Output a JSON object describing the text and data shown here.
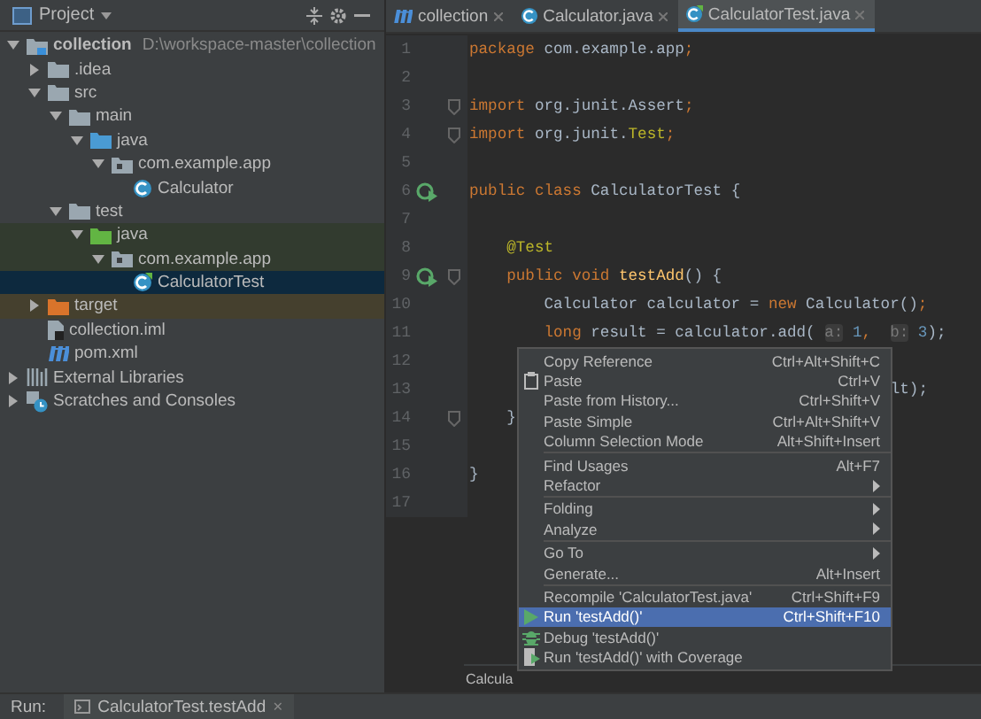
{
  "project_panel": {
    "title": "Project",
    "tree": [
      {
        "label": "collection",
        "path": "D:\\workspace-master\\collection",
        "kind": "module",
        "expanded": true,
        "selected": false,
        "children": [
          {
            "label": ".idea",
            "kind": "folder",
            "expanded": false,
            "selected": false
          },
          {
            "label": "src",
            "kind": "folder",
            "expanded": true,
            "selected": false,
            "children": [
              {
                "label": "main",
                "kind": "folder",
                "expanded": true,
                "selected": false,
                "children": [
                  {
                    "label": "java",
                    "kind": "source-folder",
                    "expanded": true,
                    "selected": false,
                    "children": [
                      {
                        "label": "com.example.app",
                        "kind": "package",
                        "expanded": true,
                        "selected": false,
                        "children": [
                          {
                            "label": "Calculator",
                            "kind": "class",
                            "selected": false
                          }
                        ]
                      }
                    ]
                  }
                ]
              },
              {
                "label": "test",
                "kind": "folder",
                "expanded": true,
                "selected": false,
                "children": [
                  {
                    "label": "java",
                    "kind": "test-folder",
                    "test_scope": true,
                    "expanded": true,
                    "selected": false,
                    "children": [
                      {
                        "label": "com.example.app",
                        "kind": "package",
                        "test_scope": true,
                        "expanded": true,
                        "selected": false,
                        "children": [
                          {
                            "label": "CalculatorTest",
                            "kind": "test-class",
                            "selected": true
                          }
                        ]
                      }
                    ]
                  }
                ]
              }
            ]
          },
          {
            "label": "target",
            "kind": "excluded-folder",
            "excluded": true,
            "expanded": false,
            "selected": false
          },
          {
            "label": "collection.iml",
            "kind": "iml-file",
            "selected": false
          },
          {
            "label": "pom.xml",
            "kind": "maven-file",
            "selected": false
          }
        ]
      },
      {
        "label": "External Libraries",
        "kind": "libraries",
        "expanded": false,
        "selected": false
      },
      {
        "label": "Scratches and Consoles",
        "kind": "scratches",
        "expanded": false,
        "selected": false
      }
    ]
  },
  "editor_tabs": [
    {
      "label": "collection",
      "kind": "maven",
      "selected": false
    },
    {
      "label": "Calculator.java",
      "kind": "class",
      "selected": false
    },
    {
      "label": "CalculatorTest.java",
      "kind": "test-class",
      "selected": true
    }
  ],
  "code_lines": [
    {
      "number": "1",
      "kind": "code",
      "tokens": [
        {
          "text": "package",
          "kind": "kw"
        },
        {
          "text": " com.example.app",
          "kind": "plain"
        },
        {
          "text": ";",
          "kind": "kw"
        }
      ]
    },
    {
      "number": "2",
      "kind": "code"
    },
    {
      "number": "3",
      "kind": "code",
      "fold": true,
      "tokens": [
        {
          "text": "import",
          "kind": "kw"
        },
        {
          "text": " org.junit.Assert",
          "kind": "plain"
        },
        {
          "text": ";",
          "kind": "kw"
        }
      ]
    },
    {
      "number": "4",
      "kind": "code",
      "fold": true,
      "tokens": [
        {
          "text": "import",
          "kind": "kw"
        },
        {
          "text": " org.junit.",
          "kind": "plain"
        },
        {
          "text": "Test",
          "kind": "ann"
        },
        {
          "text": ";",
          "kind": "kw"
        }
      ]
    },
    {
      "number": "5",
      "kind": "code"
    },
    {
      "number": "6",
      "kind": "code",
      "run": true,
      "tokens": [
        {
          "text": "public class",
          "kind": "kw"
        },
        {
          "text": " CalculatorTest {",
          "kind": "plain"
        }
      ]
    },
    {
      "number": "7",
      "kind": "code"
    },
    {
      "number": "8",
      "kind": "code",
      "tokens": [
        {
          "text": "    @Test",
          "kind": "ann"
        }
      ]
    },
    {
      "number": "9",
      "kind": "code",
      "run": true,
      "fold": true,
      "tokens": [
        {
          "text": "    public void",
          "kind": "kw"
        },
        {
          "text": " testAdd",
          "kind": "method"
        },
        {
          "text": "() {",
          "kind": "plain"
        }
      ]
    },
    {
      "number": "10",
      "kind": "code",
      "tokens": [
        {
          "text": "        Calculator calculator = ",
          "kind": "plain"
        },
        {
          "text": "new",
          "kind": "kw"
        },
        {
          "text": " Calculator()",
          "kind": "plain"
        },
        {
          "text": ";",
          "kind": "kw"
        }
      ]
    },
    {
      "number": "11",
      "kind": "code",
      "tokens": [
        {
          "text": "        long",
          "kind": "kw"
        },
        {
          "text": " result = calculator.add( ",
          "kind": "plain"
        },
        {
          "text": "a:",
          "kind": "hint"
        },
        {
          "text": " 1",
          "kind": "num"
        },
        {
          "text": ",  ",
          "kind": "kw"
        },
        {
          "text": "b:",
          "kind": "hint"
        },
        {
          "text": " 3",
          "kind": "num"
        },
        {
          "text": ");",
          "kind": "plain"
        }
      ]
    },
    {
      "number": "12",
      "kind": "code"
    },
    {
      "number": "13",
      "kind": "covered",
      "tokens": [
        {
          "text": "lt);",
          "kind": "plain"
        }
      ]
    },
    {
      "number": "14",
      "kind": "code",
      "fold": true,
      "tokens": [
        {
          "text": "    }",
          "kind": "plain"
        }
      ]
    },
    {
      "number": "15",
      "kind": "code"
    },
    {
      "number": "16",
      "kind": "code",
      "tokens": [
        {
          "text": "}",
          "kind": "plain"
        }
      ]
    },
    {
      "number": "17",
      "kind": "code"
    }
  ],
  "breadcrumb": "Calcula",
  "context_menu": [
    {
      "label": "Copy Reference",
      "shortcut": "Ctrl+Alt+Shift+C",
      "kind": "plain",
      "selected": false
    },
    {
      "label": "Paste",
      "shortcut": "Ctrl+V",
      "kind": "paste",
      "selected": false
    },
    {
      "label": "Paste from History...",
      "shortcut": "Ctrl+Shift+V",
      "kind": "plain",
      "selected": false
    },
    {
      "label": "Paste Simple",
      "shortcut": "Ctrl+Alt+Shift+V",
      "kind": "plain",
      "selected": false
    },
    {
      "label": "Column Selection Mode",
      "shortcut": "Alt+Shift+Insert",
      "kind": "plain",
      "selected": false
    },
    {
      "kind": "separator"
    },
    {
      "label": "Find Usages",
      "shortcut": "Alt+F7",
      "kind": "plain",
      "selected": false
    },
    {
      "label": "Refactor",
      "kind": "submenu",
      "selected": false
    },
    {
      "kind": "separator"
    },
    {
      "label": "Folding",
      "kind": "submenu",
      "selected": false
    },
    {
      "label": "Analyze",
      "kind": "submenu",
      "selected": false
    },
    {
      "kind": "separator"
    },
    {
      "label": "Go To",
      "kind": "submenu",
      "selected": false
    },
    {
      "label": "Generate...",
      "shortcut": "Alt+Insert",
      "kind": "plain",
      "selected": false
    },
    {
      "kind": "separator"
    },
    {
      "label": "Recompile 'CalculatorTest.java'",
      "shortcut": "Ctrl+Shift+F9",
      "kind": "plain",
      "selected": false
    },
    {
      "label": "Run 'testAdd()'",
      "shortcut": "Ctrl+Shift+F10",
      "kind": "run",
      "selected": true
    },
    {
      "label": "Debug 'testAdd()'",
      "kind": "debug",
      "selected": false
    },
    {
      "label": "Run 'testAdd()' with Coverage",
      "kind": "coverage",
      "selected": false
    }
  ],
  "run_bar": {
    "label": "Run:",
    "tab": "CalculatorTest.testAdd",
    "close": "×"
  }
}
